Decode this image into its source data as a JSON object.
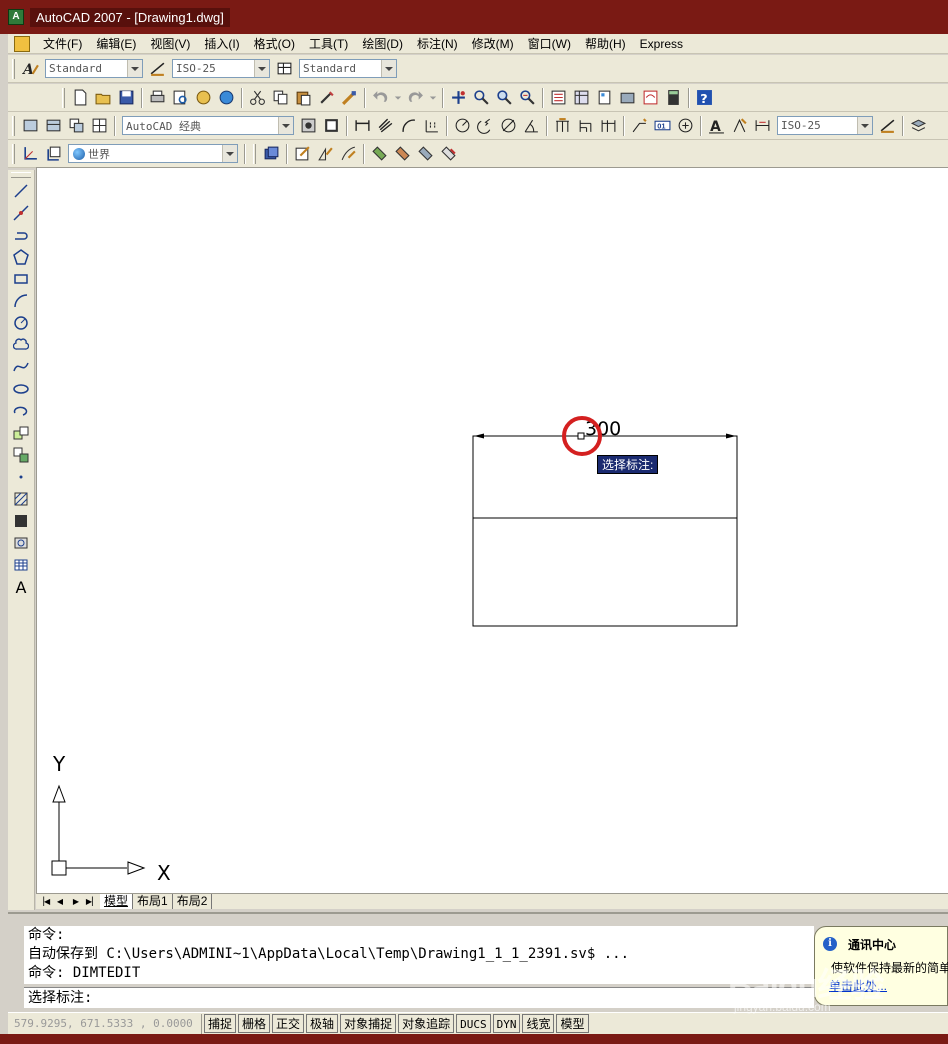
{
  "window": {
    "title": "AutoCAD 2007 - [Drawing1.dwg]"
  },
  "menubar": {
    "items": [
      "文件(F)",
      "编辑(E)",
      "视图(V)",
      "插入(I)",
      "格式(O)",
      "工具(T)",
      "绘图(D)",
      "标注(N)",
      "修改(M)",
      "窗口(W)",
      "帮助(H)",
      "Express"
    ]
  },
  "toolbars": {
    "text_style": "Standard",
    "dim_style": "ISO-25",
    "table_style": "Standard",
    "workspace": "AutoCAD 经典",
    "dim_style_2": "ISO-25",
    "ucs": "世界"
  },
  "drawing": {
    "dimension_text": "300",
    "tooltip": "选择标注:",
    "ucs_x": "X",
    "ucs_y": "Y"
  },
  "tabs": {
    "items": [
      "模型",
      "布局1",
      "布局2"
    ],
    "active": "模型"
  },
  "command": {
    "lines": [
      "命令:",
      "自动保存到 C:\\Users\\ADMINI~1\\AppData\\Local\\Temp\\Drawing1_1_1_2391.sv$ ...",
      "命令: DIMTEDIT"
    ],
    "prompt": "选择标注:"
  },
  "notification": {
    "title": "通讯中心",
    "body": "使软件保持最新的简单",
    "link": "单击此处..."
  },
  "statusbar": {
    "coords": "579.9295,  671.5333 , 0.0000",
    "buttons": [
      "捕捉",
      "栅格",
      "正交",
      "极轴",
      "对象捕捉",
      "对象追踪",
      "DUCS",
      "DYN",
      "线宽",
      "模型"
    ]
  },
  "watermark": {
    "brand": "Baidu经验",
    "url": "jingyan.baidu.com"
  },
  "colors": {
    "title_bar": "#7a1a14",
    "tooltip_bg": "#1a2a70",
    "highlight_circle": "#d42020",
    "canvas": "#ffffff"
  }
}
